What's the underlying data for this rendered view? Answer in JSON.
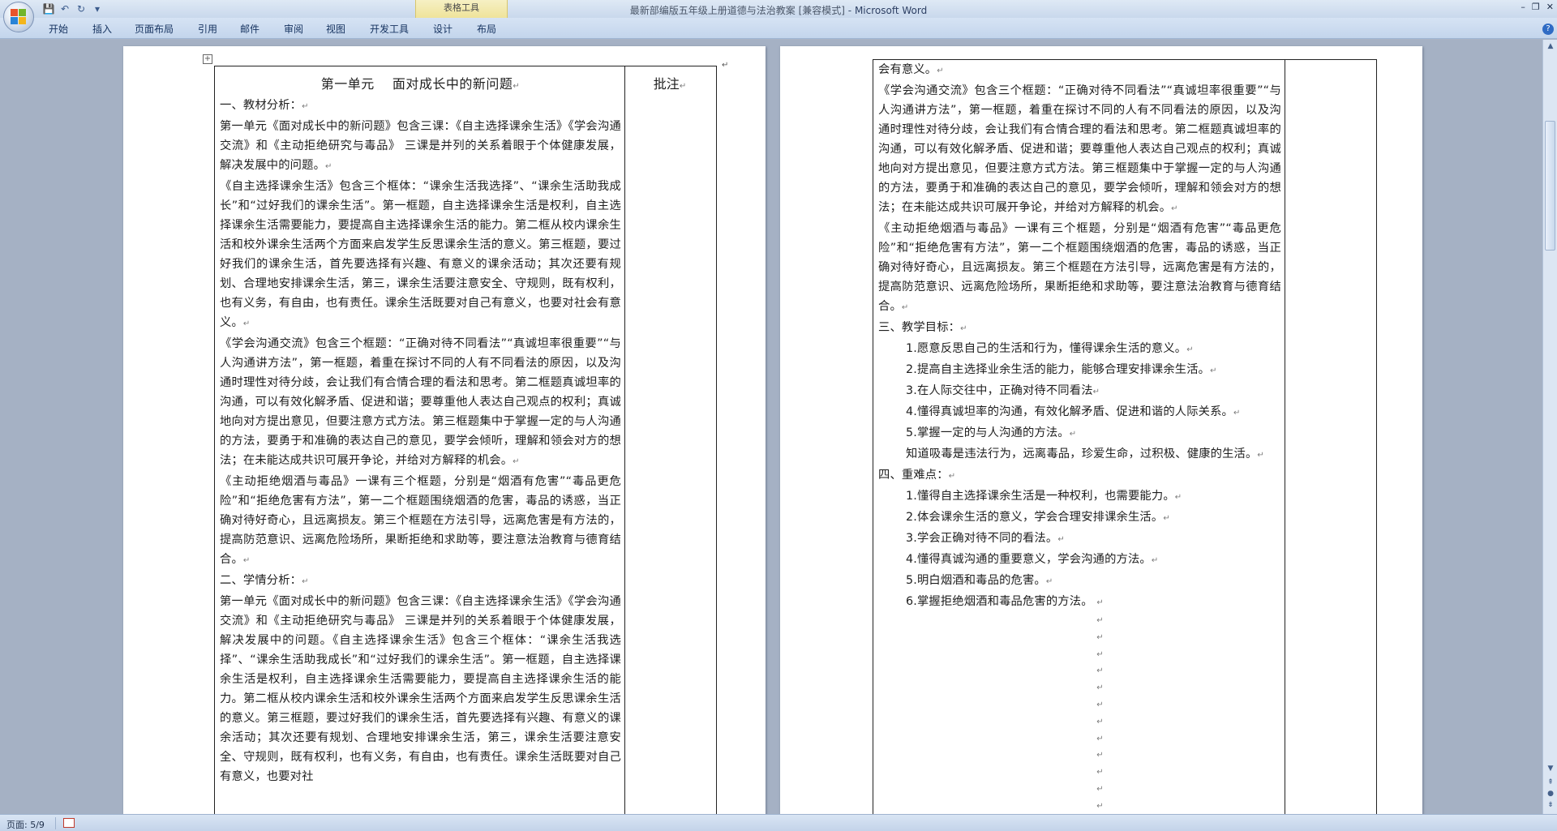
{
  "window": {
    "doc_title": "最新部编版五年级上册道德与法治教案 [兼容模式]",
    "separator": " - ",
    "app_name": "Microsoft Word",
    "context_tool": "表格工具"
  },
  "ribbon": {
    "tabs": [
      "开始",
      "插入",
      "页面布局",
      "引用",
      "邮件",
      "审阅",
      "视图",
      "开发工具",
      "设计",
      "布局"
    ]
  },
  "page1": {
    "title": "第一单元　 面对成长中的新问题",
    "note_header": "批注",
    "paragraphs": [
      "一、教材分析：",
      "第一单元《面对成长中的新问题》包含三课：《自主选择课余生活》《学会沟通交流》和《主动拒绝研究与毒品》 三课是并列的关系着眼于个体健康发展，解决发展中的问题。",
      "《自主选择课余生活》包含三个框体：“课余生活我选择”、“课余生活助我成长”和“过好我们的课余生活”。第一框题，自主选择课余生活是权利，自主选择课余生活需要能力，要提高自主选择课余生活的能力。第二框从校内课余生活和校外课余生活两个方面来启发学生反思课余生活的意义。第三框题，要过好我们的课余生活，首先要选择有兴趣、有意义的课余活动；其次还要有规划、合理地安排课余生活，第三，课余生活要注意安全、守规则，既有权利，也有义务，有自由，也有责任。课余生活既要对自己有意义，也要对社会有意义。",
      "《学会沟通交流》包含三个框题：“正确对待不同看法”“真诚坦率很重要”“与人沟通讲方法”，第一框题，着重在探讨不同的人有不同看法的原因，以及沟通时理性对待分歧，会让我们有合情合理的看法和思考。第二框题真诚坦率的沟通，可以有效化解矛盾、促进和谐；要尊重他人表达自己观点的权利；真诚地向对方提出意见，但要注意方式方法。第三框题集中于掌握一定的与人沟通的方法，要勇于和准确的表达自己的意见，要学会倾听，理解和领会对方的想法；在未能达成共识可展开争论，并给对方解释的机会。",
      "《主动拒绝烟酒与毒品》一课有三个框题，分别是“烟酒有危害”“毒品更危险”和“拒绝危害有方法”，第一二个框题围绕烟酒的危害，毒品的诱惑，当正确对待好奇心，且远离损友。第三个框题在方法引导，远离危害是有方法的，提高防范意识、远离危险场所，果断拒绝和求助等，要注意法治教育与德育结合。",
      "二、学情分析：",
      "第一单元《面对成长中的新问题》包含三课：《自主选择课余生活》《学会沟通交流》和《主动拒绝研究与毒品》 三课是并列的关系着眼于个体健康发展，解决发展中的问题。《自主选择课余生活》包含三个框体：“课余生活我选择”、“课余生活助我成长”和“过好我们的课余生活”。第一框题，自主选择课余生活是权利，自主选择课余生活需要能力，要提高自主选择课余生活的能力。第二框从校内课余生活和校外课余生活两个方面来启发学生反思课余生活的意义。第三框题，要过好我们的课余生活，首先要选择有兴趣、有意义的课余活动；其次还要有规划、合理地安排课余生活，第三，课余生活要注意安全、守规则，既有权利，也有义务，有自由，也有责任。课余生活既要对自己有意义，也要对社"
    ]
  },
  "page2": {
    "paragraphs": [
      "会有意义。",
      "《学会沟通交流》包含三个框题：“正确对待不同看法”“真诚坦率很重要”“与人沟通讲方法”，第一框题，着重在探讨不同的人有不同看法的原因，以及沟通时理性对待分歧，会让我们有合情合理的看法和思考。第二框题真诚坦率的沟通，可以有效化解矛盾、促进和谐；要尊重他人表达自己观点的权利；真诚地向对方提出意见，但要注意方式方法。第三框题集中于掌握一定的与人沟通的方法，要勇于和准确的表达自己的意见，要学会倾听，理解和领会对方的想法；在未能达成共识可展开争论，并给对方解释的机会。",
      "《主动拒绝烟酒与毒品》一课有三个框题，分别是“烟酒有危害”“毒品更危险”和“拒绝危害有方法”，第一二个框题围绕烟酒的危害，毒品的诱惑，当正确对待好奇心，且远离损友。第三个框题在方法引导，远离危害是有方法的，提高防范意识、远离危险场所，果断拒绝和求助等，要注意法治教育与德育结合。",
      "三、教学目标："
    ],
    "goals": [
      "1.愿意反思自己的生活和行为，懂得课余生活的意义。",
      "2.提高自主选择业余生活的能力，能够合理安排课余生活。",
      "3.在人际交往中，正确对待不同看法",
      "4.懂得真诚坦率的沟通，有效化解矛盾、促进和谐的人际关系。",
      "5.掌握一定的与人沟通的方法。",
      "知道吸毒是违法行为，远离毒品，珍爱生命，过积极、健康的生活。"
    ],
    "keypoints_title": "四、重难点：",
    "keypoints": [
      "1.懂得自主选择课余生活是一种权利，也需要能力。",
      "2.体会课余生活的意义，学会合理安排课余生活。",
      "3.学会正确对待不同的看法。",
      "4.懂得真诚沟通的重要意义，学会沟通的方法。",
      "5.明白烟酒和毒品的危害。",
      "6.掌握拒绝烟酒和毒品危害的方法。 "
    ]
  },
  "status": {
    "page_info": "页面: 5/9"
  },
  "icons": {
    "office": "office-logo-icon",
    "save": "save-icon",
    "undo": "undo-icon",
    "redo": "redo-icon",
    "help": "help-icon"
  }
}
